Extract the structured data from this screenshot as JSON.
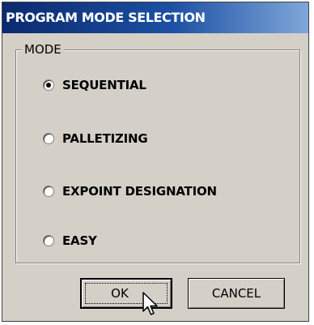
{
  "dialog": {
    "title": "PROGRAM MODE SELECTION",
    "group_label": "MODE",
    "options": [
      {
        "label": "SEQUENTIAL",
        "selected": true
      },
      {
        "label": "PALLETIZING",
        "selected": false
      },
      {
        "label": "EXPOINT DESIGNATION",
        "selected": false
      },
      {
        "label": "EASY",
        "selected": false
      }
    ],
    "buttons": {
      "ok_label": "OK",
      "cancel_label": "CANCEL"
    }
  },
  "colors": {
    "titlebar_start": "#0b2a6e",
    "titlebar_end": "#7fa7d9",
    "face": "#d4d0c8"
  },
  "icons": {
    "cursor": "mouse-pointer-icon"
  }
}
